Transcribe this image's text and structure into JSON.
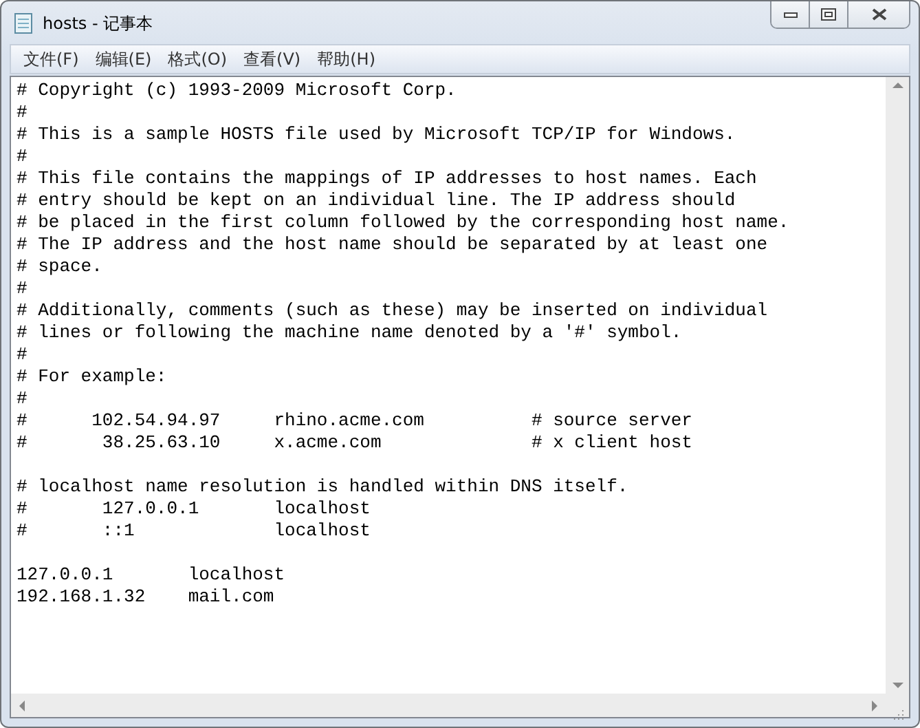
{
  "window": {
    "title": "hosts - 记事本"
  },
  "menu": [
    {
      "label": "文件(F)"
    },
    {
      "label": "编辑(E)"
    },
    {
      "label": "格式(O)"
    },
    {
      "label": "查看(V)"
    },
    {
      "label": "帮助(H)"
    }
  ],
  "lines": [
    {
      "kind": "text",
      "text": "# Copyright (c) 1993-2009 Microsoft Corp."
    },
    {
      "kind": "text",
      "text": "#"
    },
    {
      "kind": "text",
      "text": "# This is a sample HOSTS file used by Microsoft TCP/IP for Windows."
    },
    {
      "kind": "text",
      "text": "#"
    },
    {
      "kind": "text",
      "text": "# This file contains the mappings of IP addresses to host names. Each"
    },
    {
      "kind": "text",
      "text": "# entry should be kept on an individual line. The IP address should"
    },
    {
      "kind": "text",
      "text": "# be placed in the first column followed by the corresponding host name."
    },
    {
      "kind": "text",
      "text": "# The IP address and the host name should be separated by at least one"
    },
    {
      "kind": "text",
      "text": "# space."
    },
    {
      "kind": "text",
      "text": "#"
    },
    {
      "kind": "text",
      "text": "# Additionally, comments (such as these) may be inserted on individual"
    },
    {
      "kind": "text",
      "text": "# lines or following the machine name denoted by a '#' symbol."
    },
    {
      "kind": "text",
      "text": "#"
    },
    {
      "kind": "text",
      "text": "# For example:"
    },
    {
      "kind": "text",
      "text": "#"
    },
    {
      "kind": "text",
      "text": "#      102.54.94.97     rhino.acme.com          # source server"
    },
    {
      "kind": "text",
      "text": "#       38.25.63.10     x.acme.com              # x client host"
    },
    {
      "kind": "blank"
    },
    {
      "kind": "text",
      "text": "# localhost name resolution is handled within DNS itself."
    },
    {
      "kind": "text",
      "text": "#       127.0.0.1       localhost"
    },
    {
      "kind": "text",
      "text": "#       ::1             localhost"
    },
    {
      "kind": "blank"
    },
    {
      "kind": "text",
      "text": "127.0.0.1       localhost"
    },
    {
      "kind": "text",
      "text": "192.168.1.32    mail.com"
    }
  ]
}
